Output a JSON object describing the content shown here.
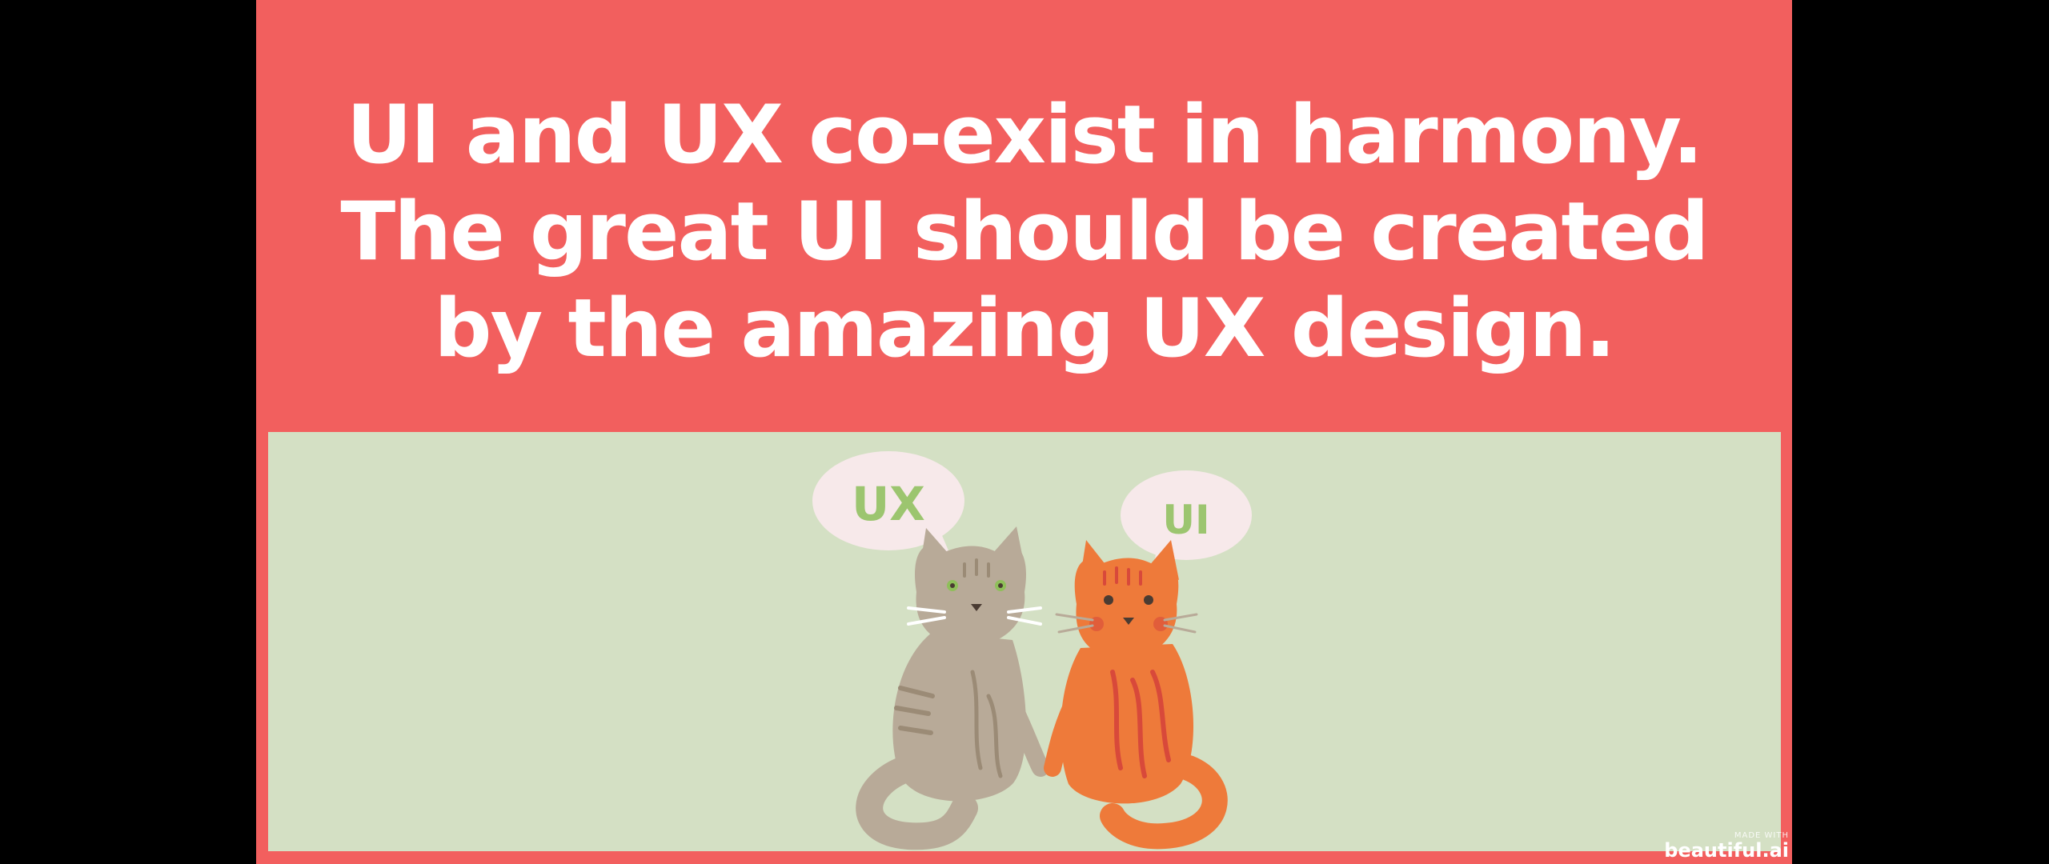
{
  "slide": {
    "headline_lines": [
      "UI and UX co-exist in harmony.",
      "The great UI should be created",
      "by the amazing UX design."
    ],
    "bubbles": {
      "left": "UX",
      "right": "UI"
    },
    "watermark": {
      "small": "MADE WITH",
      "brand": "beautiful.ai"
    }
  },
  "colors": {
    "background": "#000000",
    "slide_red": "#f25f5e",
    "panel_green": "#d4e0c4",
    "bubble": "#f7e9ea",
    "bubble_text": "#9cc56f",
    "gray_cat": "#b8aa98",
    "orange_cat": "#ee7a3a",
    "orange_stripes": "#d8493a"
  },
  "icons": [
    "gray-cat-icon",
    "orange-cat-icon",
    "speech-bubble-icon"
  ]
}
